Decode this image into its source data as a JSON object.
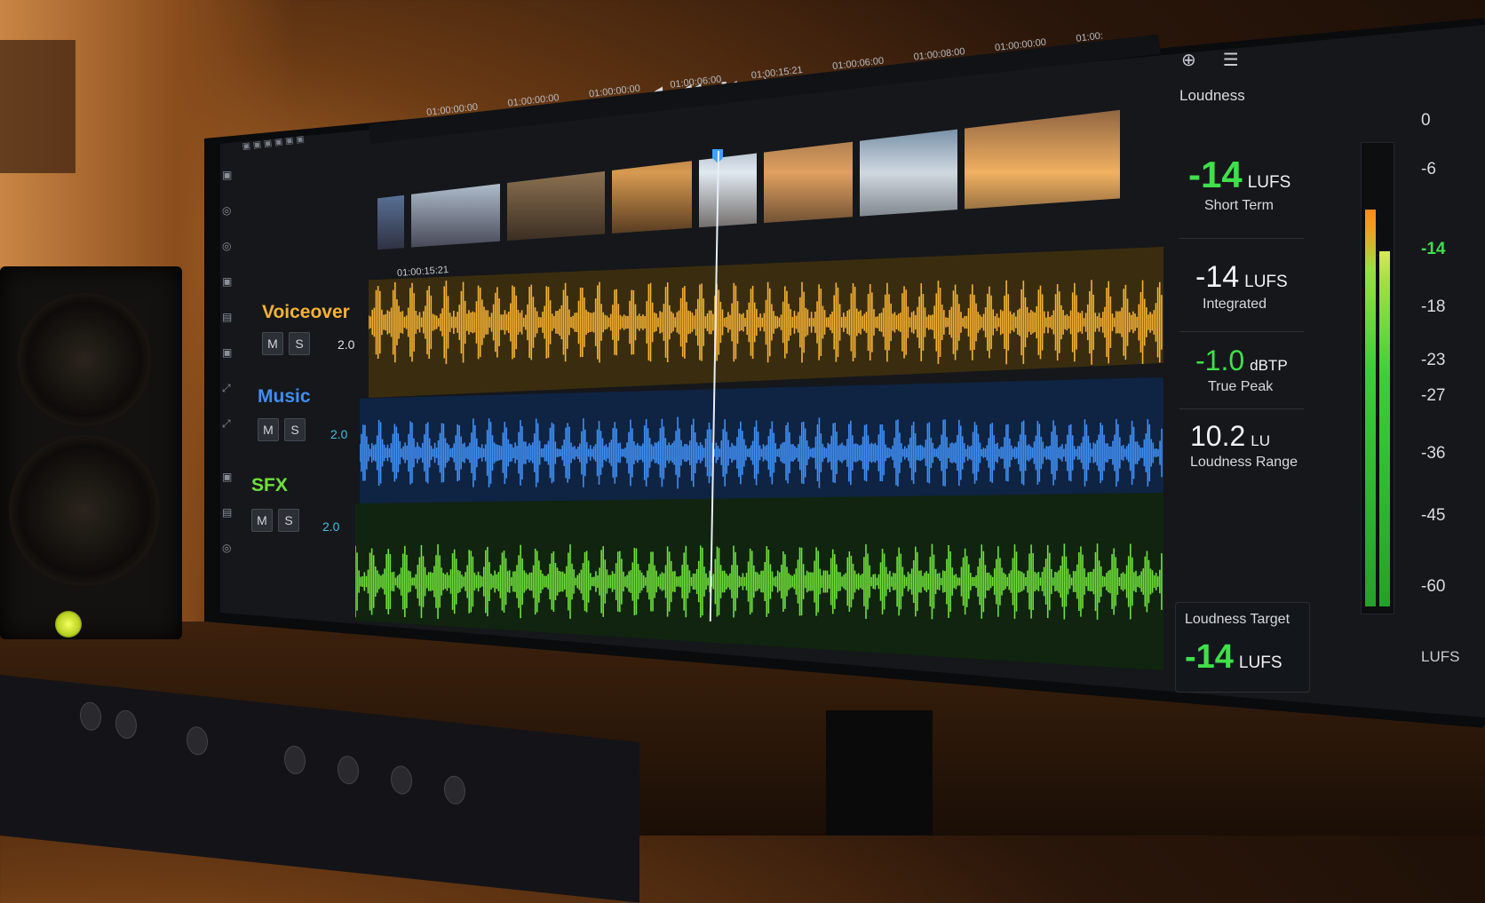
{
  "colors": {
    "voiceover": "#f5b232",
    "music": "#3f8ef2",
    "sfx": "#6fe03a",
    "meter_green": "#3fe04a"
  },
  "transport": {
    "icons": [
      "play-reverse-icon",
      "rewind-icon",
      "step-back-icon",
      "loop-icon",
      "record-icon",
      "step-forward-icon",
      "skip-icon",
      "snap-icon",
      "fast-forward-icon"
    ],
    "glyphs": [
      "◀",
      "◀◀",
      "▮◀",
      "⤾",
      "○",
      "▶▮",
      "▶▮",
      "⊡",
      "▶▶"
    ]
  },
  "timeline": {
    "timecodes": [
      "01:00:00:00",
      "01:00:00:00",
      "01:00:00:00",
      "01:00:06:00",
      "01:00:15:21",
      "01:00:06:00",
      "01:00:08:00",
      "01:00:00:00",
      "01:00:"
    ],
    "current_timecode": "01:00:15:21"
  },
  "tracks": [
    {
      "name": "Voiceover",
      "mute": "M",
      "solo": "S",
      "value": "2.0",
      "color": "#f5b232"
    },
    {
      "name": "Music",
      "mute": "M",
      "solo": "S",
      "value": "2.0",
      "color": "#3f8ef2"
    },
    {
      "name": "SFX",
      "mute": "M",
      "solo": "S",
      "value": "2.0",
      "color": "#6fe03a"
    }
  ],
  "loudness": {
    "title": "Loudness",
    "short_term": {
      "value": "-14",
      "unit": "LUFS",
      "label": "Short Term"
    },
    "integrated": {
      "value": "-14",
      "unit": "LUFS",
      "label": "Integrated"
    },
    "true_peak": {
      "value": "-1.0",
      "unit": "dBTP",
      "label": "True Peak"
    },
    "range": {
      "value": "10.2",
      "unit": "LU",
      "label": "Loudness Range"
    },
    "target": {
      "label": "Loudness Target",
      "value": "-14",
      "unit": "LUFS"
    },
    "meter_scale": [
      "0",
      "-6",
      "-14",
      "-18",
      "-23",
      "-27",
      "-36",
      "-45",
      "-60"
    ],
    "meter_unit": "LUFS",
    "meter_left_level": 0.86,
    "meter_right_level": 0.77
  }
}
